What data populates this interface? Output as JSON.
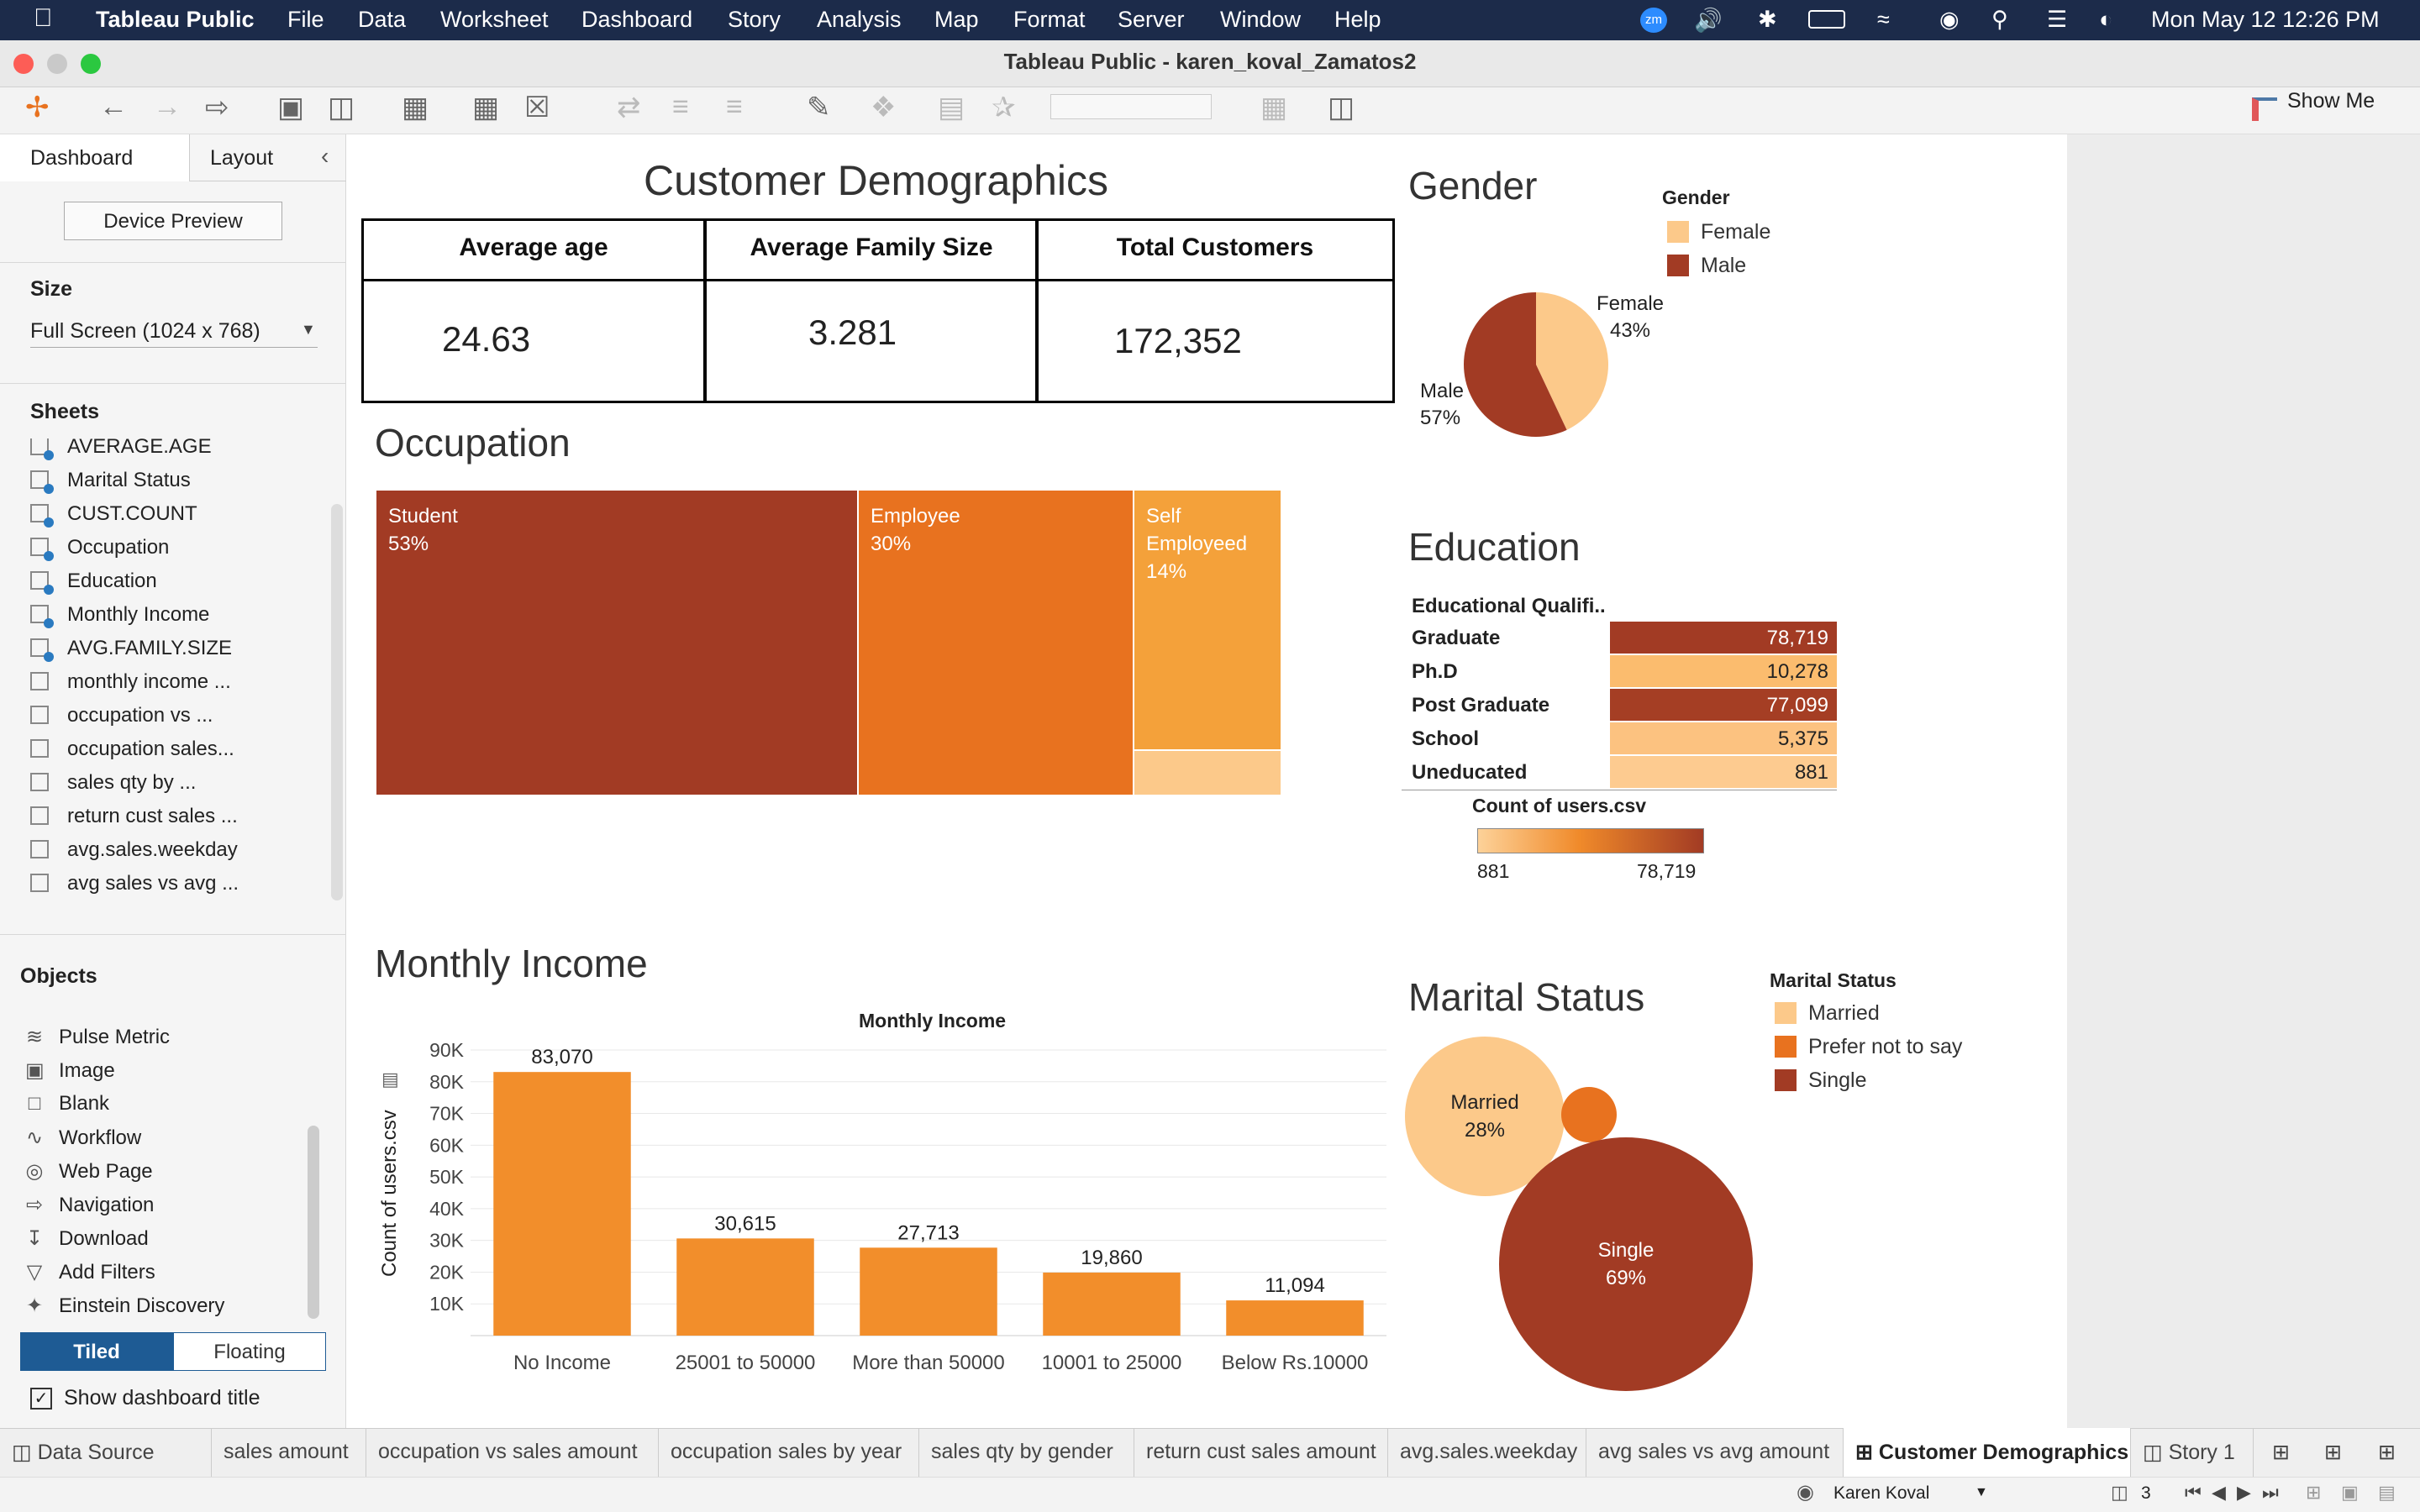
{
  "menubar": {
    "app": "Tableau Public",
    "items": [
      "File",
      "Data",
      "Worksheet",
      "Dashboard",
      "Story",
      "Analysis",
      "Map",
      "Format",
      "Server",
      "Window",
      "Help"
    ],
    "clock": "Mon May 12  12:26 PM",
    "zoom_badge": "zm"
  },
  "window": {
    "title": "Tableau Public - karen_koval_Zamatos2"
  },
  "toolbar": {
    "show_me": "Show Me"
  },
  "left_panel": {
    "tabs": [
      "Dashboard",
      "Layout"
    ],
    "device_preview": "Device Preview",
    "size_label": "Size",
    "size_value": "Full Screen (1024 x 768)",
    "sheets_label": "Sheets",
    "sheets": [
      "AVERAGE.AGE",
      "Marital Status",
      "CUST.COUNT",
      "Occupation",
      "Education",
      "Monthly Income",
      "AVG.FAMILY.SIZE",
      "monthly income ...",
      "occupation vs ...",
      "occupation sales...",
      "sales qty by ...",
      "return cust sales ...",
      "avg.sales.weekday",
      "avg sales vs avg ..."
    ],
    "objects_label": "Objects",
    "objects": [
      "Pulse Metric",
      "Image",
      "Blank",
      "Workflow",
      "Web Page",
      "Navigation",
      "Download",
      "Add Filters",
      "Einstein Discovery"
    ],
    "tiled": "Tiled",
    "floating": "Floating",
    "show_title": "Show dashboard title"
  },
  "dashboard": {
    "title": "Customer Demographics",
    "kpis": [
      {
        "label": "Average age",
        "value": "24.63"
      },
      {
        "label": "Average Family Size",
        "value": "3.281"
      },
      {
        "label": "Total Customers",
        "value": "172,352"
      }
    ],
    "occupation": {
      "title": "Occupation",
      "tiles": [
        {
          "line1": "Student",
          "line2": "53%"
        },
        {
          "line1": "Employee",
          "line2": "30%"
        },
        {
          "line1": "Self",
          "line2": "Employeed",
          "line3": "14%"
        }
      ]
    },
    "gender": {
      "title": "Gender",
      "legend_title": "Gender",
      "legend": [
        "Female",
        "Male"
      ],
      "female_label": "Female",
      "female_pct": "43%",
      "male_label": "Male",
      "male_pct": "57%"
    },
    "education": {
      "title": "Education",
      "header": "Educational Qualifi..",
      "rows": [
        {
          "label": "Graduate",
          "value": "78,719"
        },
        {
          "label": "Ph.D",
          "value": "10,278"
        },
        {
          "label": "Post Graduate",
          "value": "77,099"
        },
        {
          "label": "School",
          "value": "5,375"
        },
        {
          "label": "Uneducated",
          "value": "881"
        }
      ],
      "scale_title": "Count of users.csv",
      "scale_min": "881",
      "scale_max": "78,719"
    },
    "income": {
      "title": "Monthly Income",
      "chart_title": "Monthly Income",
      "ylabel": "Count of users.csv"
    },
    "marital": {
      "title": "Marital Status",
      "legend_title": "Marital Status",
      "legend": [
        "Married",
        "Prefer not to say",
        "Single"
      ],
      "married_label": "Married",
      "married_pct": "28%",
      "single_label": "Single",
      "single_pct": "69%"
    }
  },
  "colors": {
    "dark": "#a23b24",
    "orange": "#e8721f",
    "light_orange": "#f4a13a",
    "pale": "#fcc98a",
    "bar": "#f28e2b"
  },
  "chart_data": [
    {
      "type": "pie",
      "title": "Gender",
      "categories": [
        "Female",
        "Male"
      ],
      "values": [
        43,
        57
      ]
    },
    {
      "type": "bar",
      "title": "Monthly Income",
      "categories": [
        "No Income",
        "25001 to 50000",
        "More than 50000",
        "10001 to 25000",
        "Below Rs.10000"
      ],
      "values": [
        83070,
        30615,
        27713,
        19860,
        11094
      ],
      "value_labels": [
        "83,070",
        "30,615",
        "27,713",
        "19,860",
        "11,094"
      ],
      "ylabel": "Count of users.csv",
      "yticks": [
        "10K",
        "20K",
        "30K",
        "40K",
        "50K",
        "60K",
        "70K",
        "80K",
        "90K"
      ],
      "ylim": [
        0,
        90000
      ],
      "grid": true
    },
    {
      "type": "heatmap",
      "title": "Education",
      "categories": [
        "Graduate",
        "Ph.D",
        "Post Graduate",
        "School",
        "Uneducated"
      ],
      "values": [
        78719,
        10278,
        77099,
        5375,
        881
      ]
    },
    {
      "type": "pie",
      "title": "Marital Status",
      "categories": [
        "Married",
        "Prefer not to say",
        "Single"
      ],
      "values": [
        28,
        3,
        69
      ]
    }
  ]
}
